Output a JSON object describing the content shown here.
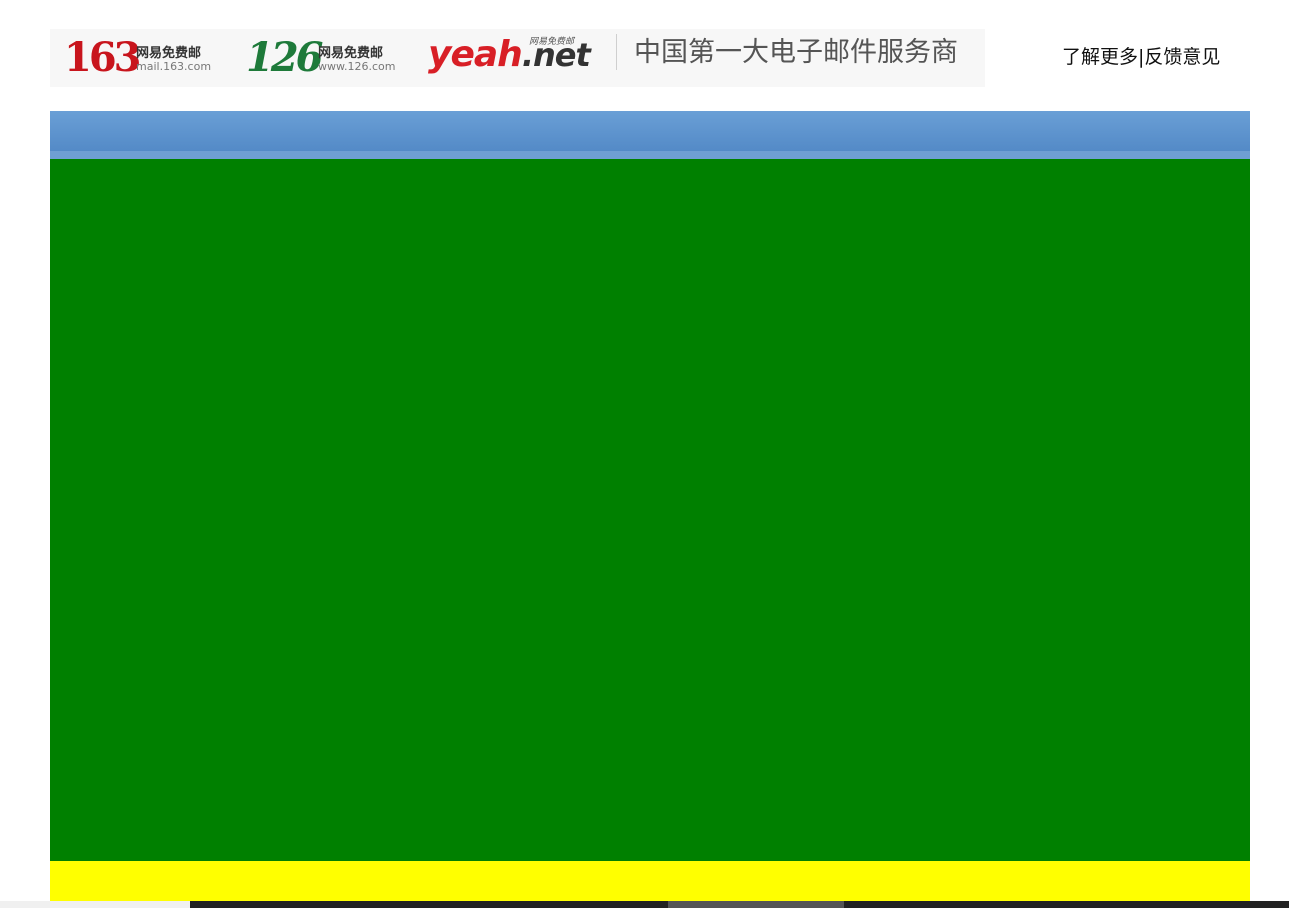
{
  "banner": {
    "brand_163": {
      "number": "163",
      "name": "网易免费邮",
      "domain": "mail.163.com"
    },
    "brand_126": {
      "number": "126",
      "name": "网易免费邮",
      "domain": "www.126.com"
    },
    "brand_yeah": {
      "word": "yeah",
      "tld": ".net",
      "name": "网易免费邮"
    },
    "slogan": "中国第一大电子邮件服务商"
  },
  "top_links": {
    "learn_more": "了解更多",
    "separator": "|",
    "feedback": "反馈意见"
  },
  "colors": {
    "header_bar": "#5b8fcb",
    "main_area": "#008000",
    "footer_area": "#ffff00",
    "brand_163": "#c8151d",
    "brand_126": "#1e7a3a",
    "brand_yeah": "#d81f26"
  }
}
